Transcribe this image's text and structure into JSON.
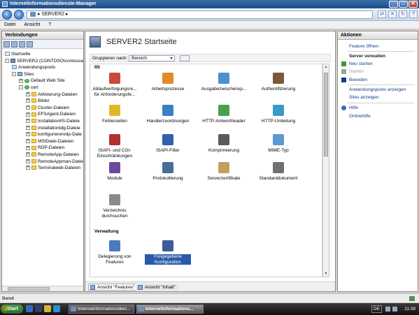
{
  "window": {
    "title": "Internetinformationsdienste-Manager",
    "buttons": [
      "_",
      "□",
      "✕"
    ]
  },
  "address": {
    "path": "SERVER2",
    "separator": "▸"
  },
  "menu": [
    "Datei",
    "Ansicht",
    "?"
  ],
  "connections": {
    "title": "Verbindungen",
    "tree": [
      {
        "label": "Startseite",
        "icon": "page"
      },
      {
        "label": "SERVER2 (CONTOSO\\contosoad",
        "icon": "server",
        "expander": "-"
      },
      {
        "label": "Anwendungspools",
        "icon": "pool"
      },
      {
        "label": "Sites",
        "icon": "sites",
        "expander": "-"
      },
      {
        "label": "Default Web Site",
        "icon": "globe",
        "expander": "+"
      },
      {
        "label": "cert",
        "icon": "globe",
        "expander": "-"
      },
      {
        "label": "Aktivierung-Dateien",
        "icon": "folder",
        "expander": "+"
      },
      {
        "label": "Bilder",
        "icon": "folder",
        "expander": "+"
      },
      {
        "label": "Cluster-Dateien",
        "icon": "folder",
        "expander": "+"
      },
      {
        "label": "EFSAgent-Dateien",
        "icon": "folder",
        "expander": "+"
      },
      {
        "label": "InstallationIIS-Dateie",
        "icon": "folder",
        "expander": "+"
      },
      {
        "label": "installationtdg-Dateie",
        "icon": "folder",
        "expander": "+"
      },
      {
        "label": "konfigurierenrdp-Date",
        "icon": "folder",
        "expander": "+"
      },
      {
        "label": "MSIDatei-Dateien",
        "icon": "folder",
        "expander": "+"
      },
      {
        "label": "RDP-Dateien",
        "icon": "folder",
        "expander": "+"
      },
      {
        "label": "RemoteApp-Dateien",
        "icon": "folder",
        "expander": "+"
      },
      {
        "label": "RemoteAppman-Dateie",
        "icon": "folder",
        "expander": "+"
      },
      {
        "label": "Terminalweb-Dateien",
        "icon": "folder",
        "expander": "+"
      }
    ]
  },
  "center": {
    "title": "SERVER2 Startseite",
    "group_by_label": "Gruppieren nach:",
    "group_by_value": "Bereich",
    "section_iis": "IIS",
    "section_verwaltung": "Verwaltung",
    "tiles": [
      {
        "label": "Ablaufverfolgungsre... für Anforderungsfe...",
        "icon": "failed-request-tracing-icon",
        "color": "#c84a3a"
      },
      {
        "label": "Arbeitsprozesse",
        "icon": "worker-processes-icon",
        "color": "#e08a2a"
      },
      {
        "label": "Ausgabezwischensp...",
        "icon": "output-caching-icon",
        "color": "#4f8fd0"
      },
      {
        "label": "Authentifizierung",
        "icon": "authentication-icon",
        "color": "#7a5a3a"
      },
      {
        "label": "Fehlerseiten",
        "icon": "error-pages-icon",
        "color": "#e2b72c"
      },
      {
        "label": "Handlerzuordnungen",
        "icon": "handler-mappings-icon",
        "color": "#3a7fc4"
      },
      {
        "label": "HTTP-Antwortheader",
        "icon": "http-response-headers-icon",
        "color": "#4aa04a"
      },
      {
        "label": "HTTP-Umleitung",
        "icon": "http-redirect-icon",
        "color": "#3a9ac4"
      },
      {
        "label": "ISAPI- und CGI-Einschränkungen",
        "icon": "isapi-cgi-restrictions-icon",
        "color": "#b03030"
      },
      {
        "label": "ISAPI-Filter",
        "icon": "isapi-filters-icon",
        "color": "#3060b0"
      },
      {
        "label": "Komprimierung",
        "icon": "compression-icon",
        "color": "#5a5a5a"
      },
      {
        "label": "MIME-Typ",
        "icon": "mime-types-icon",
        "color": "#5a9ad0"
      },
      {
        "label": "Module",
        "icon": "modules-icon",
        "color": "#6a4aa0"
      },
      {
        "label": "Protokollierung",
        "icon": "logging-icon",
        "color": "#4a6a9a"
      },
      {
        "label": "Serverzertifikate",
        "icon": "server-certificates-icon",
        "color": "#c0a060"
      },
      {
        "label": "Standarddokument",
        "icon": "default-document-icon",
        "color": "#707070"
      },
      {
        "label": "Verzeichnis durchsuchen",
        "icon": "directory-browsing-icon",
        "color": "#8a8a8a"
      }
    ],
    "admin_tiles": [
      {
        "label": "Delegierung von Features",
        "icon": "feature-delegation-icon",
        "color": "#4a7ac0"
      },
      {
        "label": "Freigegebene Konfiguration",
        "icon": "shared-configuration-icon",
        "color": "#3a5aa0"
      }
    ],
    "tabs": {
      "features": "Ansicht \"Features\"",
      "content": "Ansicht \"Inhalt\""
    }
  },
  "actions": {
    "title": "Aktionen",
    "items": [
      {
        "label": "Feature öffnen",
        "type": "link"
      },
      {
        "label": "Server verwalten",
        "type": "head"
      },
      {
        "label": "Neu starten",
        "type": "link",
        "icon": "restart"
      },
      {
        "label": "Starten",
        "type": "disabled",
        "icon": "start"
      },
      {
        "label": "Beenden",
        "type": "link",
        "icon": "stop"
      },
      {
        "label": "Anwendungspools anzeigen",
        "type": "link"
      },
      {
        "label": "Sites anzeigen",
        "type": "link"
      },
      {
        "label": "Hilfe",
        "type": "link",
        "icon": "help"
      },
      {
        "label": "Onlinehilfe",
        "type": "link"
      }
    ]
  },
  "status": {
    "text": "Bereit"
  },
  "taskbar": {
    "start": "Start",
    "tasks": [
      {
        "label": "Internetinformationsdien...",
        "active": false
      },
      {
        "label": "Internetinformations...",
        "active": true
      }
    ],
    "language": "DE",
    "clock": "11:39"
  }
}
